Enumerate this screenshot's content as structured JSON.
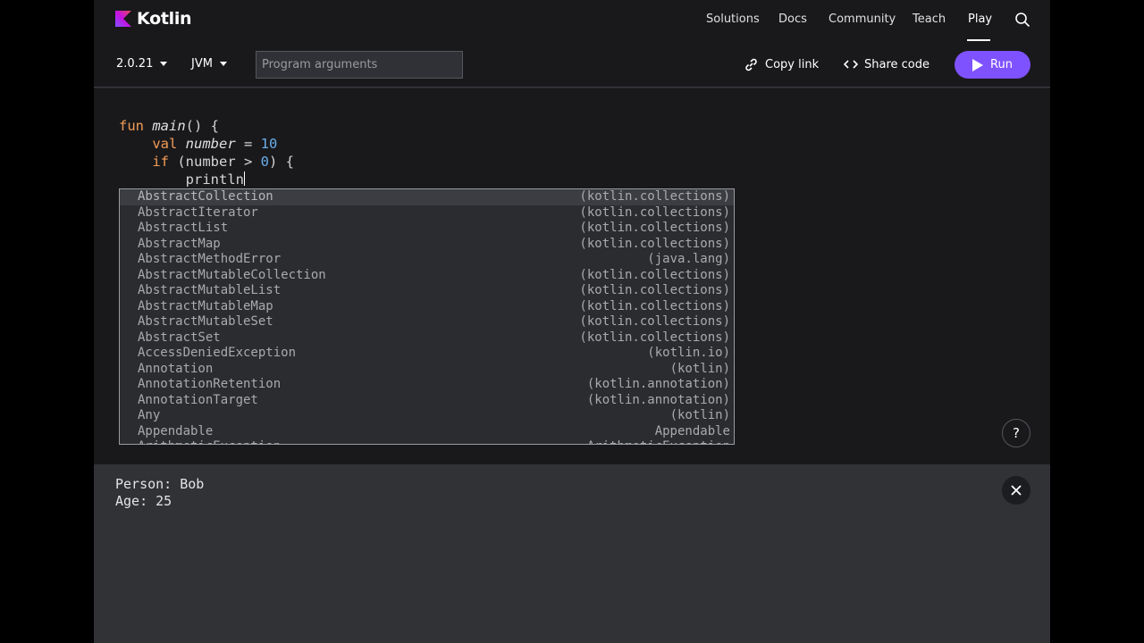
{
  "nav": {
    "brand": "Kotlin",
    "links": [
      "Solutions",
      "Docs",
      "Community",
      "Teach",
      "Play"
    ],
    "active": "Play",
    "accent_color": "#7f52ff"
  },
  "toolbar": {
    "version": "2.0.21",
    "target": "JVM",
    "args_placeholder": "Program arguments",
    "copy_link": "Copy link",
    "share_code": "Share code",
    "run": "Run"
  },
  "editor": {
    "lines": [
      [
        "fun",
        "main",
        "() {"
      ],
      [
        "val",
        "number",
        " = ",
        "10"
      ],
      [
        "if",
        " (number > ",
        "0",
        ") {"
      ],
      [
        "println"
      ]
    ]
  },
  "autocomplete": [
    {
      "name": "AbstractCollection",
      "pkg": "(kotlin.collections)"
    },
    {
      "name": "AbstractIterator",
      "pkg": "(kotlin.collections)"
    },
    {
      "name": "AbstractList",
      "pkg": "(kotlin.collections)"
    },
    {
      "name": "AbstractMap",
      "pkg": "(kotlin.collections)"
    },
    {
      "name": "AbstractMethodError",
      "pkg": "(java.lang)"
    },
    {
      "name": "AbstractMutableCollection",
      "pkg": "(kotlin.collections)"
    },
    {
      "name": "AbstractMutableList",
      "pkg": "(kotlin.collections)"
    },
    {
      "name": "AbstractMutableMap",
      "pkg": "(kotlin.collections)"
    },
    {
      "name": "AbstractMutableSet",
      "pkg": "(kotlin.collections)"
    },
    {
      "name": "AbstractSet",
      "pkg": "(kotlin.collections)"
    },
    {
      "name": "AccessDeniedException",
      "pkg": "(kotlin.io)"
    },
    {
      "name": "Annotation",
      "pkg": "(kotlin)"
    },
    {
      "name": "AnnotationRetention",
      "pkg": "(kotlin.annotation)"
    },
    {
      "name": "AnnotationTarget",
      "pkg": "(kotlin.annotation)"
    },
    {
      "name": "Any",
      "pkg": "(kotlin)"
    },
    {
      "name": "Appendable",
      "pkg": "Appendable"
    },
    {
      "name": "ArithmeticException",
      "pkg": "ArithmeticException"
    }
  ],
  "help": "?",
  "output": {
    "lines": [
      "Person: Bob",
      "Age: 25"
    ]
  }
}
